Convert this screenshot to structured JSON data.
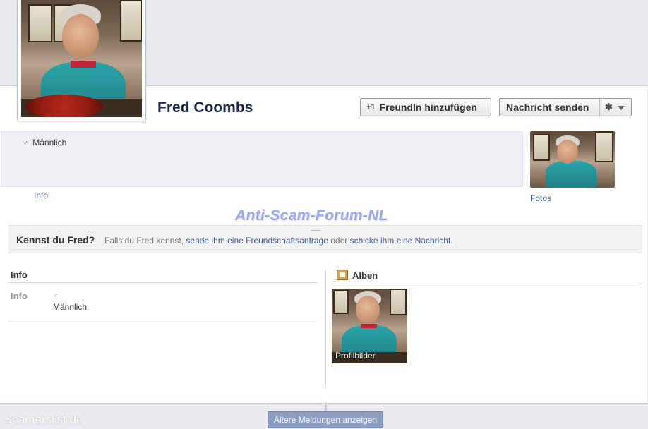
{
  "profile": {
    "name": "Fred Coombs",
    "gender": "Männlich",
    "gender_symbol": "♂"
  },
  "actions": {
    "add_friend_label": "FreundIn hinzufügen",
    "add_friend_symbol": "+1",
    "message_label": "Nachricht senden",
    "settings_symbol": "✱"
  },
  "links": {
    "info": "Info",
    "fotos": "Fotos"
  },
  "watermark": "Anti-Scam-Forum-NL",
  "know": {
    "question": "Kennst du Fred?",
    "prefix": "Falls du Fred kennst,",
    "link1": "sende ihm eine Freundschaftsanfrage",
    "middle": "oder",
    "link2": "schicke ihm eine Nachricht",
    "suffix": "."
  },
  "info_section": {
    "title": "Info",
    "row_label": "Info",
    "row_symbol": "♂",
    "row_value": "Männlich"
  },
  "albums": {
    "title": "Alben",
    "items": [
      {
        "caption": "Profilbilder"
      }
    ]
  },
  "footer": {
    "older_button": "Ältere Meldungen anzeigen",
    "site": "Scamerslist.de"
  },
  "colors": {
    "link": "#3b5998",
    "name": "#1c2a47",
    "background": "#e9ebee",
    "older_button": "#8b9dc3"
  }
}
